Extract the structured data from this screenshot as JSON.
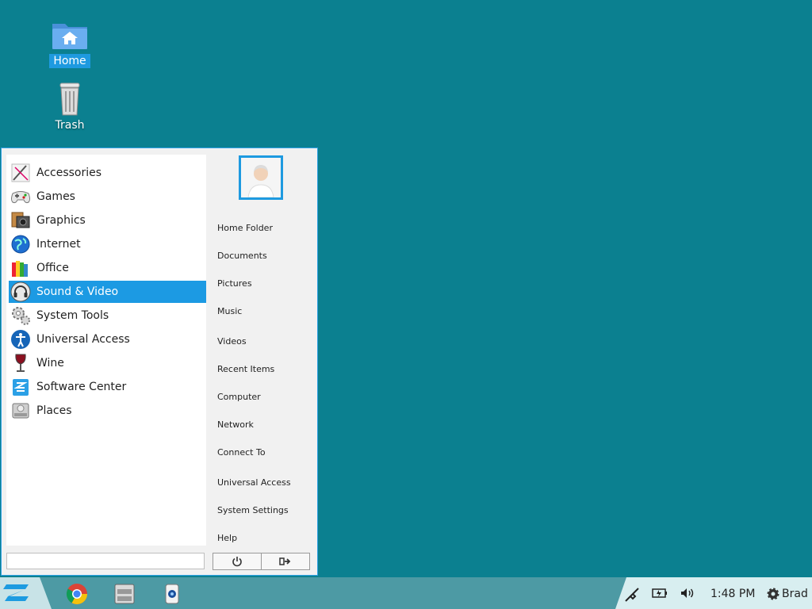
{
  "desktop": {
    "icons": [
      {
        "label": "Home",
        "icon": "home-folder-icon",
        "selected": true
      },
      {
        "label": "Trash",
        "icon": "trash-icon",
        "selected": false
      }
    ]
  },
  "menu": {
    "categories": [
      {
        "label": "Accessories",
        "icon": "accessories-icon"
      },
      {
        "label": "Games",
        "icon": "gamepad-icon"
      },
      {
        "label": "Graphics",
        "icon": "graphics-icon"
      },
      {
        "label": "Internet",
        "icon": "globe-icon"
      },
      {
        "label": "Office",
        "icon": "office-icon"
      },
      {
        "label": "Sound & Video",
        "icon": "headphones-icon",
        "active": true
      },
      {
        "label": "System Tools",
        "icon": "gears-icon"
      },
      {
        "label": "Universal Access",
        "icon": "accessibility-icon"
      },
      {
        "label": "Wine",
        "icon": "wine-glass-icon"
      },
      {
        "label": "Software Center",
        "icon": "software-center-icon"
      },
      {
        "label": "Places",
        "icon": "drive-icon"
      }
    ],
    "places": [
      "Home Folder",
      "Documents",
      "Pictures",
      "Music",
      "Videos",
      "Recent Items",
      "Computer",
      "Network",
      "Connect To",
      "Universal Access",
      "System Settings",
      "Help"
    ],
    "search": {
      "value": "",
      "placeholder": ""
    },
    "buttons": {
      "power": "power-icon",
      "logout": "logout-icon"
    }
  },
  "taskbar": {
    "start_icon": "zorin-logo-icon",
    "apps": [
      "chrome-icon",
      "file-manager-icon",
      "camera-icon"
    ],
    "tray": [
      "network-icon",
      "battery-icon",
      "volume-icon"
    ],
    "clock": "1:48 PM",
    "user": "Brad"
  },
  "colors": {
    "desktop": "#0b8090",
    "accent": "#1e9ae0",
    "taskbar": "#4d9aa4"
  }
}
